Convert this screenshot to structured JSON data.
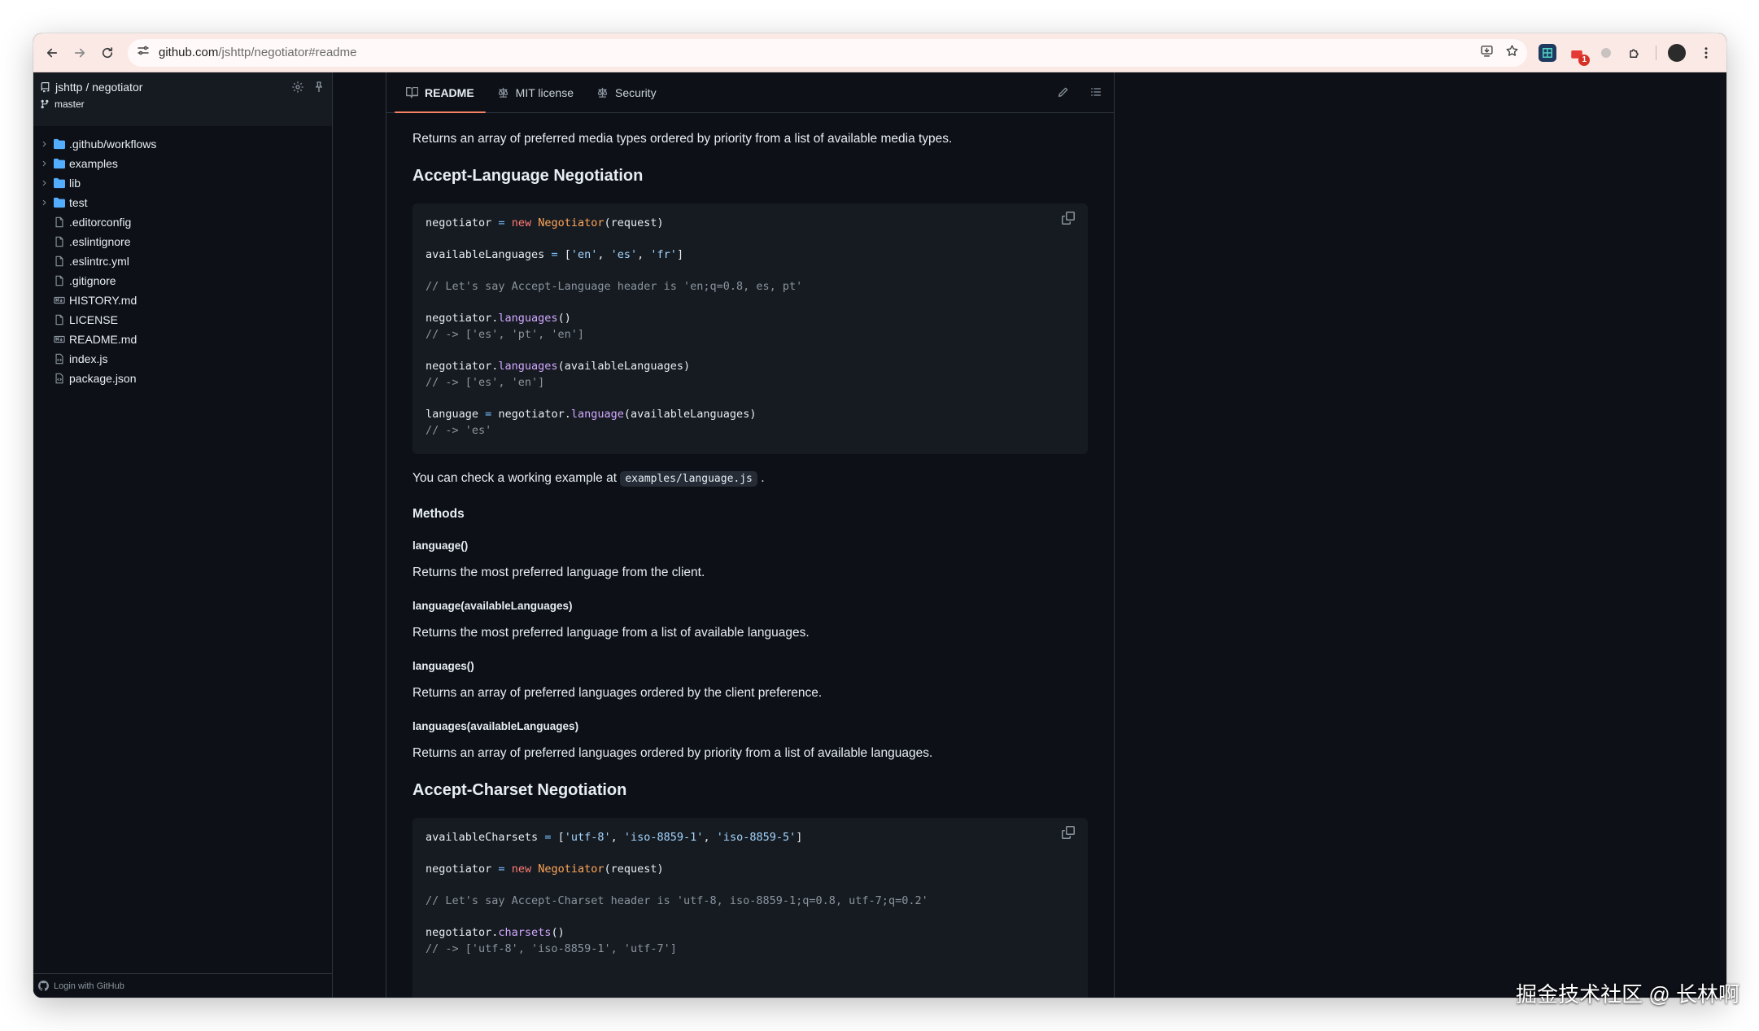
{
  "browser": {
    "url_host": "github.com",
    "url_path": "/jshttp/negotiator#readme"
  },
  "sidebar": {
    "repo_title": "jshttp / negotiator",
    "branch": "master",
    "tree": [
      {
        "label": ".github/workflows",
        "type": "folder"
      },
      {
        "label": "examples",
        "type": "folder"
      },
      {
        "label": "lib",
        "type": "folder"
      },
      {
        "label": "test",
        "type": "folder"
      },
      {
        "label": ".editorconfig",
        "type": "file"
      },
      {
        "label": ".eslintignore",
        "type": "file"
      },
      {
        "label": ".eslintrc.yml",
        "type": "file"
      },
      {
        "label": ".gitignore",
        "type": "file"
      },
      {
        "label": "HISTORY.md",
        "type": "markdown"
      },
      {
        "label": "LICENSE",
        "type": "file"
      },
      {
        "label": "README.md",
        "type": "markdown"
      },
      {
        "label": "index.js",
        "type": "js"
      },
      {
        "label": "package.json",
        "type": "js"
      }
    ],
    "footer": "Login with GitHub"
  },
  "tabs": [
    {
      "label": "README",
      "active": true
    },
    {
      "label": "MIT license",
      "active": false
    },
    {
      "label": "Security",
      "active": false
    }
  ],
  "readme": {
    "intro": "Returns an array of preferred media types ordered by priority from a list of available media types.",
    "h_language": "Accept-Language Negotiation",
    "example_prefix": "You can check a working example at",
    "example_code": "examples/language.js",
    "example_suffix": ".",
    "methods": "Methods",
    "m1_name": "language()",
    "m1_desc": "Returns the most preferred language from the client.",
    "m2_name": "language(availableLanguages)",
    "m2_desc": "Returns the most preferred language from a list of available languages.",
    "m3_name": "languages()",
    "m3_desc": "Returns an array of preferred languages ordered by the client preference.",
    "m4_name": "languages(availableLanguages)",
    "m4_desc": "Returns an array of preferred languages ordered by priority from a list of available languages.",
    "h_charset": "Accept-Charset Negotiation"
  },
  "code_language": {
    "l1_var": "negotiator",
    "l1_new": "new",
    "l1_cls": "Negotiator",
    "l1_args": "(request)",
    "l2_var": "availableLanguages",
    "l2_s1": "'en'",
    "l2_s2": "'es'",
    "l2_s3": "'fr'",
    "l3_comment": "// Let's say Accept-Language header is 'en;q=0.8, es, pt'",
    "l4_obj": "negotiator.",
    "l4_fn": "languages",
    "l4_args": "()",
    "l5_comment": "// -> ['es', 'pt', 'en']",
    "l6_obj": "negotiator.",
    "l6_fn": "languages",
    "l6_args": "(availableLanguages)",
    "l7_comment": "// -> ['es', 'en']",
    "l8_var": "language",
    "l8_obj": "negotiator.",
    "l8_fn": "language",
    "l8_args": "(availableLanguages)",
    "l9_comment": "// -> 'es'"
  },
  "code_charset": {
    "l1_var": "availableCharsets",
    "l1_s1": "'utf-8'",
    "l1_s2": "'iso-8859-1'",
    "l1_s3": "'iso-8859-5'",
    "l2_var": "negotiator",
    "l2_new": "new",
    "l2_cls": "Negotiator",
    "l2_args": "(request)",
    "l3_comment": "// Let's say Accept-Charset header is 'utf-8, iso-8859-1;q=0.8, utf-7;q=0.2'",
    "l4_obj": "negotiator.",
    "l4_fn": "charsets",
    "l4_args": "()",
    "l5_comment": "// -> ['utf-8', 'iso-8859-1', 'utf-7']"
  },
  "watermark": "掘金技术社区 @ 长林啊"
}
